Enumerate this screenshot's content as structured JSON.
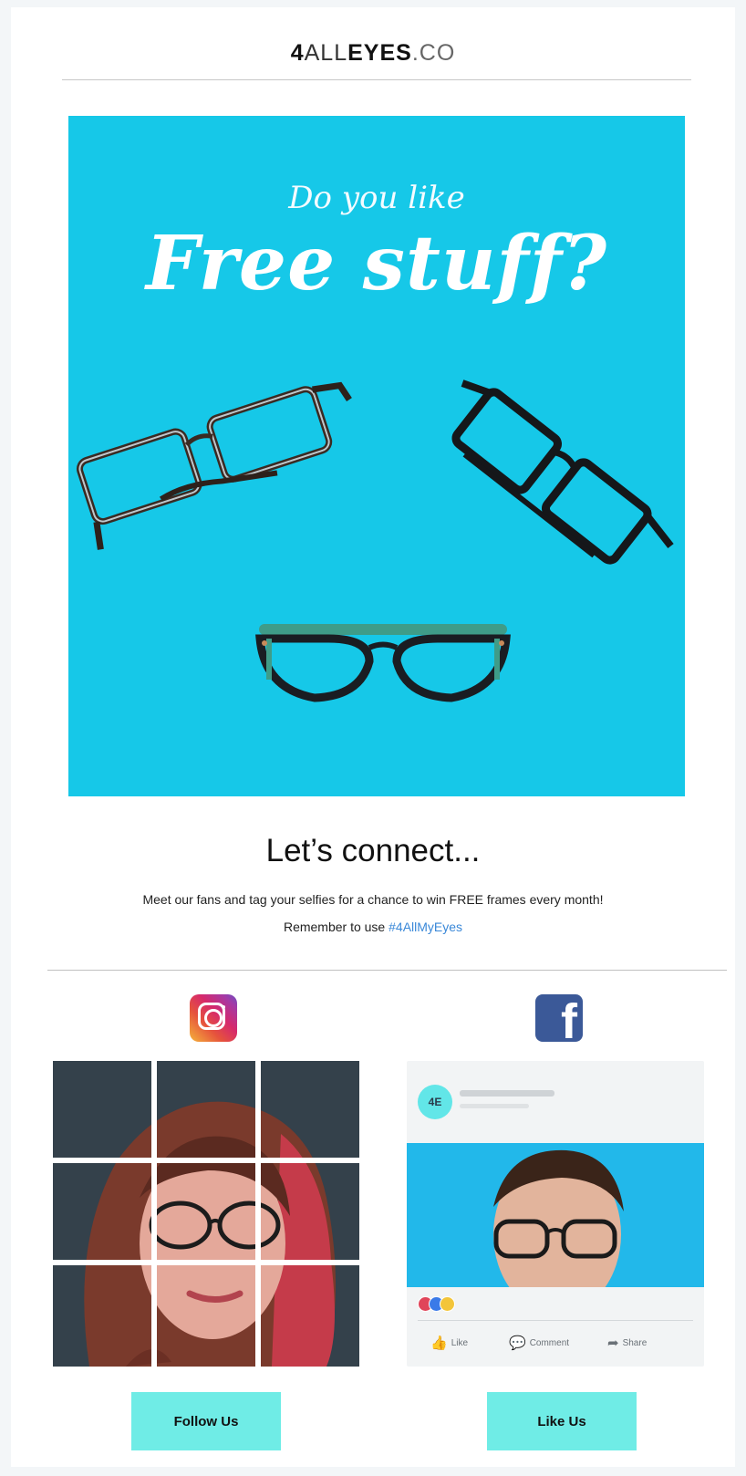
{
  "header": {
    "logo_digit": "4",
    "logo_all": "ALL",
    "logo_eyes": "EYES",
    "logo_tld": ".CO"
  },
  "hero": {
    "subtitle": "Do you like",
    "headline": "Free stuff?",
    "background_color": "#16c8e8"
  },
  "connect": {
    "title": "Let’s connect...",
    "body": "Meet our fans and tag your selfies for a chance to win FREE frames every month!",
    "reminder_prefix": "Remember to use ",
    "hashtag": "#4AllMyEyes",
    "hashtag_color": "#3a88d8"
  },
  "instagram": {
    "icon": "instagram-icon",
    "button_label": "Follow Us"
  },
  "facebook": {
    "icon": "facebook-icon",
    "icon_glyph": "f",
    "avatar_text": "4E",
    "actions": [
      {
        "icon": "like-icon",
        "label": "Like"
      },
      {
        "icon": "comment-icon",
        "label": "Comment"
      },
      {
        "icon": "share-icon",
        "label": "Share"
      }
    ],
    "button_label": "Like Us"
  },
  "colors": {
    "button": "#6fece6",
    "facebook_blue": "#3b5998"
  }
}
